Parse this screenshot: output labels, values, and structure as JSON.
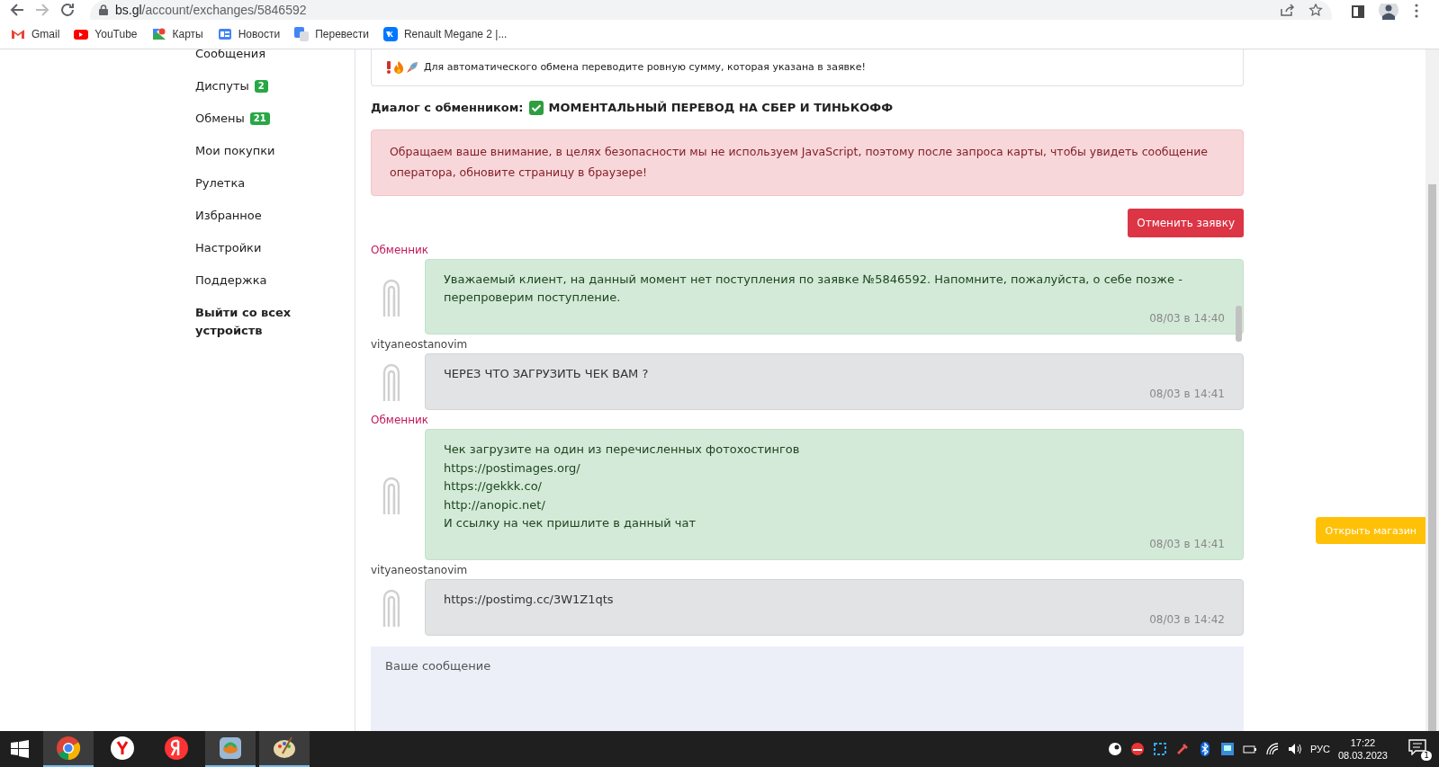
{
  "browser": {
    "url_host": "bs.gl",
    "url_path": "/account/exchanges/5846592",
    "bookmarks": [
      {
        "label": "Gmail",
        "kind": "gmail"
      },
      {
        "label": "YouTube",
        "kind": "youtube"
      },
      {
        "label": "Карты",
        "kind": "maps"
      },
      {
        "label": "Новости",
        "kind": "news"
      },
      {
        "label": "Перевести",
        "kind": "translate"
      },
      {
        "label": "Renault Megane 2 |...",
        "kind": "vk"
      }
    ]
  },
  "sidebar": {
    "items": [
      {
        "label": "Сообщения",
        "bold": false
      },
      {
        "label": "Диспуты",
        "badge": "2",
        "bold": false
      },
      {
        "label": "Обмены",
        "badge": "21",
        "bold": false
      },
      {
        "label": "Мои покупки",
        "bold": false
      },
      {
        "label": "Рулетка",
        "bold": false
      },
      {
        "label": "Избранное",
        "bold": false
      },
      {
        "label": "Настройки",
        "bold": false
      },
      {
        "label": "Поддержка",
        "bold": false
      },
      {
        "label": "Выйти со всех устройств",
        "bold": true
      }
    ]
  },
  "notice": {
    "text": "Для автоматического обмена переводите ровную сумму, которая указана в заявке!"
  },
  "dialog": {
    "label": "Диалог с обменником:",
    "title": "МОМЕНТАЛЬНЫЙ ПЕРЕВОД НА СБЕР И ТИНЬКОФФ"
  },
  "alert": {
    "text": "Обращаем ваше внимание, в целях безопасности мы не используем JavaScript, поэтому после запроса карты, чтобы увидеть сообщение оператора, обновите страницу в браузере!"
  },
  "cancel_button": "Отменить заявку",
  "messages": [
    {
      "author": "Обменник",
      "kind": "operator",
      "lines": [
        "Уважаемый клиент, на данный момент нет поступления по заявке №5846592. Напомните, пожалуйста, о себе позже - перепроверим поступление."
      ],
      "time": "08/03 в 14:40"
    },
    {
      "author": "vityaneostanovim",
      "kind": "user",
      "lines": [
        "ЧЕРЕЗ ЧТО ЗАГРУЗИТЬ ЧЕК ВАМ ?"
      ],
      "time": "08/03 в 14:41"
    },
    {
      "author": "Обменник",
      "kind": "operator",
      "lines": [
        "Чек загрузите на один из перечисленных фотохостингов",
        "https://postimages.org/",
        "https://gekkk.co/",
        "http://anopic.net/",
        "И ссылку на чек пришлите в данный чат"
      ],
      "time": "08/03 в 14:41"
    },
    {
      "author": "vityaneostanovim",
      "kind": "user",
      "lines": [
        "https://postimg.cc/3W1Z1qts"
      ],
      "time": "08/03 в 14:42"
    }
  ],
  "message_input": {
    "placeholder": "Ваше сообщение"
  },
  "shop_button": "Открыть магазин",
  "taskbar": {
    "apps": [
      {
        "kind": "chrome",
        "selected": true
      },
      {
        "kind": "yandex-browser",
        "selected": false
      },
      {
        "kind": "yandex",
        "selected": false
      },
      {
        "kind": "app",
        "selected": true
      },
      {
        "kind": "paint",
        "selected": true
      }
    ],
    "language": "РУС",
    "time": "17:22",
    "date": "08.03.2023",
    "notifications": "1"
  }
}
